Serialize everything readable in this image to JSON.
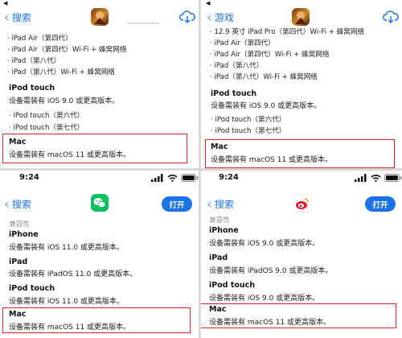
{
  "top_left": {
    "status_glyph": "◀",
    "back_label": "搜索",
    "app_icon": "game-warrior-icon",
    "action_icon": "cloud-download-icon",
    "bullets": [
      "iPad Air（第四代）",
      "iPad Air（第四代）Wi-Fi + 蜂窝网络",
      "iPad（第八代）",
      "iPad（第八代）Wi-Fi + 蜂窝网络"
    ],
    "ipod_title": "iPod touch",
    "ipod_req": "设备需装有 iOS 9.0 或更高版本。",
    "ipod_bullets": [
      "iPod touch（第六代）",
      "iPod touch（第七代）"
    ],
    "mac_title": "Mac",
    "mac_req": "设备需装有 macOS 11 或更高版本。"
  },
  "top_right": {
    "status_glyph": "◀",
    "back_label": "游戏",
    "app_icon": "game-warrior-icon",
    "action_icon": "cloud-download-icon",
    "bullets": [
      "12.9 英寸 iPad Pro（第四代）Wi-Fi + 蜂窝网络",
      "iPad Air（第四代）",
      "iPad Air（第四代）Wi-Fi + 蜂窝网络",
      "iPad（第八代）",
      "iPad（第八代）Wi-Fi + 蜂窝网络"
    ],
    "ipod_title": "iPod touch",
    "ipod_req": "设备需装有 iOS 9.0 或更高版本。",
    "ipod_bullets": [
      "iPod touch（第六代）",
      "iPod touch（第七代）"
    ],
    "mac_title": "Mac",
    "mac_req": "设备需装有 macOS 11 或更高版本。"
  },
  "bottom_left": {
    "time": "9:24",
    "back_label": "搜索",
    "app_icon": "wechat-icon",
    "open_label": "打开",
    "section_label": "兼容性",
    "iphone_title": "iPhone",
    "iphone_req": "设备需装有 iOS 11.0 或更高版本。",
    "ipad_title": "iPad",
    "ipad_req": "设备需装有 iPadOS 11.0 或更高版本。",
    "ipod_title": "iPod touch",
    "ipod_req": "设备需装有 iOS 11.0 或更高版本。",
    "mac_title": "Mac",
    "mac_req": "设备需装有 macOS 11 或更高版本。",
    "brand_colors": {
      "wechat_green": "#07c160"
    }
  },
  "bottom_right": {
    "time": "9:24",
    "back_label": "搜索",
    "app_icon": "weibo-icon",
    "open_label": "打开",
    "section_label": "兼容性",
    "iphone_title": "iPhone",
    "iphone_req": "设备需装有 iOS 9.0 或更高版本。",
    "ipad_title": "iPad",
    "ipad_req": "设备需装有 iPadOS 9.0 或更高版本。",
    "ipod_title": "iPod touch",
    "ipod_req": "设备需装有 iOS 9.0 或更高版本。",
    "mac_title": "Mac",
    "mac_req": "设备需装有 macOS 11 或更高版本。"
  },
  "colors": {
    "accent": "#1a73e8",
    "highlight_box": "#e02424"
  }
}
